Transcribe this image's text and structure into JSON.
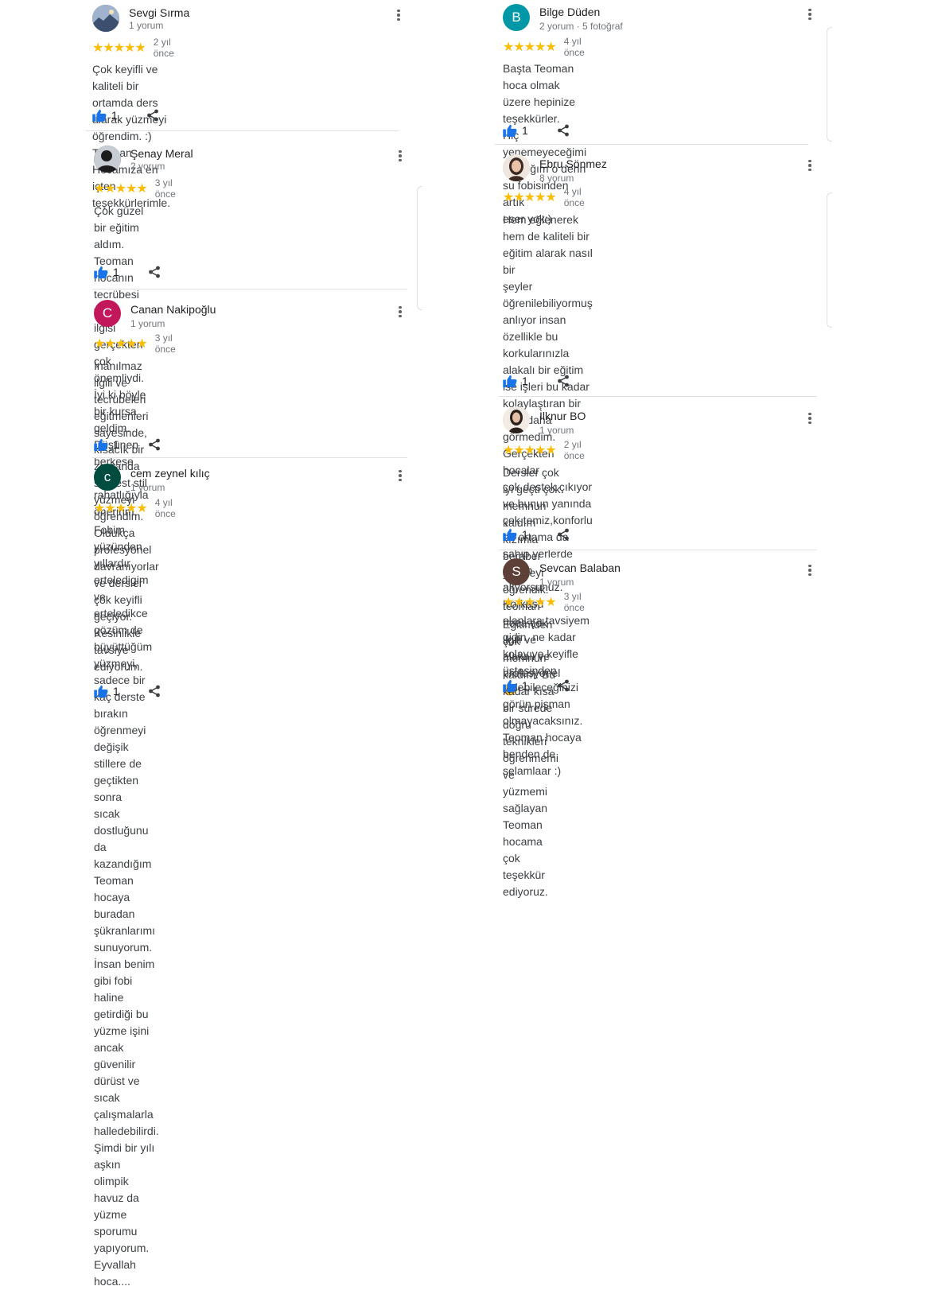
{
  "reviews": [
    {
      "name": "Sevgi Sırma",
      "meta": "1 yorum",
      "time": "2 yıl önce",
      "stars": "★★★★★",
      "likes": "1",
      "avatar": {
        "letter": "",
        "color": "#4a5d7a"
      },
      "text": "Çok keyifli  ve kaliteli bir ortamda  ders alarak yüzmeyi\nöğrendim. :) Teoman Hocamıza en içten teşekkürlerimle."
    },
    {
      "name": "Şenay Meral",
      "meta": "2 yorum",
      "time": "3 yıl önce",
      "stars": "★★★★★",
      "likes": "1",
      "avatar": {
        "letter": "",
        "color": "#2b2b2b"
      },
      "text": "Çok güzel bir eğitim  aldım. Teoman hocanın tecrübesi ve\nilgisi gerçekten çok önemliydi. İyi ki böyle bir kursa\ngeldim. Düşünen herkese gönül rahatlığıyla öneririm."
    },
    {
      "name": "Canan Nakipoğlu",
      "meta": "1 yorum",
      "time": "3 yıl önce",
      "stars": "★★★★★",
      "likes": "1",
      "avatar": {
        "letter": "C",
        "color": "#c2185b"
      },
      "text": "İnanılmaz ilgili ve tecrübeleri eğitmenleri sayesinde,\nkısacık bir zamanda serbest stil yüzmeyi öğrendim.\nOldukça profesyonel davranıyorlar ve dersler çok keyifli\ngeçiyor. Kesinlikle tavsiye ediyorum."
    },
    {
      "name": "cem zeynel kılıç",
      "meta": "1 yorum",
      "time": "4 yıl önce",
      "stars": "★★★★★",
      "likes": "1",
      "avatar": {
        "letter": "c",
        "color": "#004d40"
      },
      "text": "Fobim yüzünden yıllardır erteledigim ve erteledikce\ngözüm de büyüttüğüm yüzmeyi, sadece bir kaç derste\nbırakın öğrenmeyi değişik stillere de geçtikten sonra\nsıcak dostluğunu da kazandığım Teoman hocaya\nburadan şükranlarımı sunuyorum. İnsan benim gibi fobi\nhaline getirdiği bu yüzme işini ancak güvenilir dürüst ve\nsıcak çalışmalarla halledebilirdi. Şimdi bir yılı aşkın\nolimpik havuz da yüzme sporumu yapıyorum. Eyvallah\nhoca...."
    },
    {
      "name": "Bilge Düden",
      "meta": "2 yorum · 5 fotoğraf",
      "time": "4 yıl önce",
      "stars": "★★★★★",
      "likes": "1",
      "avatar": {
        "letter": "B",
        "color": "#0097a7"
      },
      "text": "Başta Teoman hoca olmak üzere hepinize teşekkürler.\nHiç yenemeyeceğimi sandığım o derin su fobisinden artık\neser yok:)"
    },
    {
      "name": "Ebru Sönmez",
      "meta": "8 yorum",
      "time": "4 yıl önce",
      "stars": "★★★★★",
      "likes": "1",
      "avatar": {
        "letter": "",
        "color": "#d9c2b5"
      },
      "text": "Hem eğlenerek hem de kaliteli bir eğitim alarak nasıl bir\nşeyler öğrenilebiliyormuş anlıyor insan özellikle bu\nkorkularınızla alakalı bir eğitim ise işleri bu kadar\nkolaylaştıran bir kurs daha görmedim. Gerçekten hocalar\nçok destek çıkıyor ve bunun yanında çok temiz,konforlu\nbir ortama da sahip yerlerde eğitim alıyorsunuz. Korkusu\nolanlara tavsiyem gidin, ne kadar kolay ve keyifle\nüstesinden gelebileceğinizi görün pişman\nolmayacaksınız. Teoman hocaya benden de selamlaar :)"
    },
    {
      "name": "İlknur BO",
      "meta": "1 yorum",
      "time": "2 yıl önce",
      "stars": "★★★★★",
      "likes": "1",
      "avatar": {
        "letter": "",
        "color": "#e6d9cc"
      },
      "text": "Dersler çok iyi geçti çok memnun kaldım kızımla beraber\nyüzmeyi  öğrendik.  teoman hoca çok ilgili  ve alakalı  ve\nprofesyonel 😊"
    },
    {
      "name": "Sevcan Balaban",
      "meta": "1 yorum",
      "time": "3 yıl önce",
      "stars": "★★★★★",
      "likes": "1",
      "avatar": {
        "letter": "S",
        "color": "#5d4037"
      },
      "text": "Eğitimden çok memnun kaldım. Bu kadar kısa bir sürede\ndoğru teknikleri öğrenmemi ve yüzmemi sağlayan\nTeoman hocama çok teşekkür ediyoruz."
    }
  ]
}
